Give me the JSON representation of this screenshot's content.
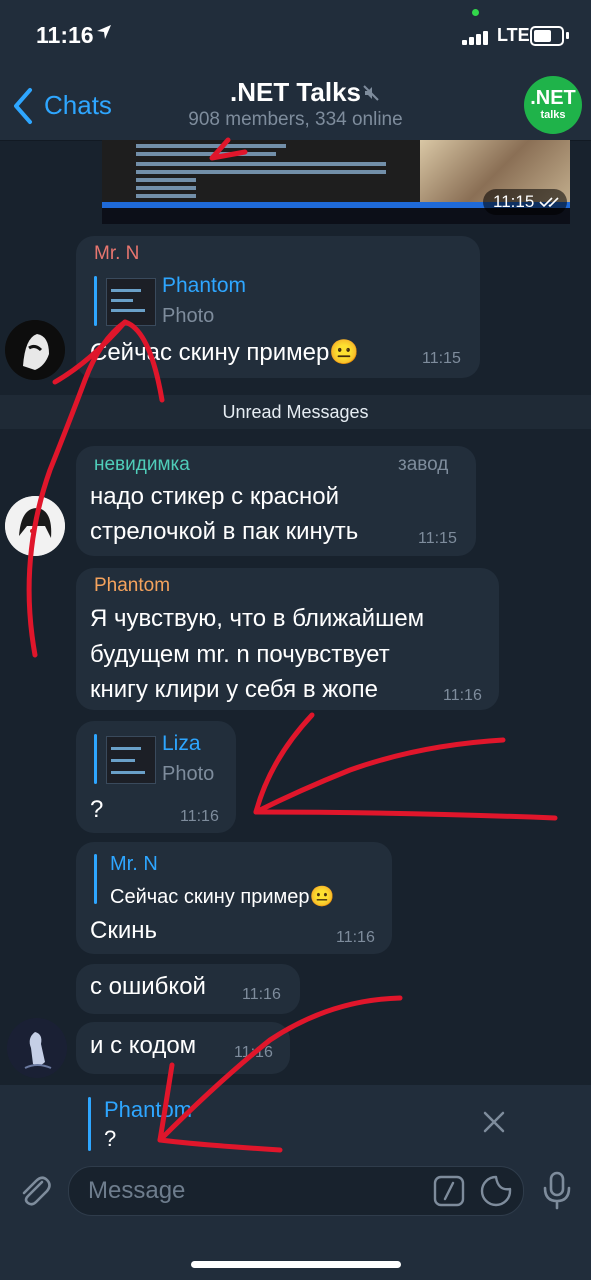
{
  "status": {
    "time": "11:16",
    "network": "LTE"
  },
  "header": {
    "back_label": "Chats",
    "title": ".NET Talks",
    "subtitle": "908 members, 334 online",
    "avatar_line1": ".NET",
    "avatar_line2": "talks"
  },
  "media_message": {
    "time": "11:15"
  },
  "messages": [
    {
      "sender": "Mr. N",
      "quote_name": "Phantom",
      "quote_text": "Photo",
      "text": "Сейчас скину пример😐",
      "time": "11:15"
    },
    {
      "sender": "невидимка",
      "tag": "завод",
      "text_lines": [
        "надо стикер с красной",
        "стрелочкой в пак кинуть"
      ],
      "time": "11:15"
    },
    {
      "sender": "Phantom",
      "text_lines": [
        "Я чувствую, что в ближайшем",
        "будущем mr. n почувствует",
        "книгу клири у себя в жопе"
      ],
      "time": "11:16"
    },
    {
      "quote_name": "Liza",
      "quote_text": "Photo",
      "text": "?",
      "time": "11:16"
    },
    {
      "quote_name": "Mr. N",
      "quote_text": "Сейчас скину пример😐",
      "text": "Скинь",
      "time": "11:16"
    },
    {
      "text": "с ошибкой",
      "time": "11:16"
    },
    {
      "text": "и с кодом",
      "time": "11:16"
    }
  ],
  "unread_label": "Unread Messages",
  "reply": {
    "name": "Phantom",
    "text": "?"
  },
  "composer": {
    "placeholder": "Message"
  },
  "colors": {
    "background": "#18222d",
    "bubble": "#222e3b",
    "accent": "#2ea6ff",
    "name_red": "#e8766f",
    "name_green": "#4fcdb9",
    "name_orange": "#f5a35d",
    "annotation": "#e0162b"
  },
  "icons": [
    "location-arrow-icon",
    "mute-icon",
    "back-chevron-icon",
    "read-check-icon",
    "close-icon",
    "attach-icon",
    "command-icon",
    "sticker-icon",
    "microphone-icon"
  ]
}
